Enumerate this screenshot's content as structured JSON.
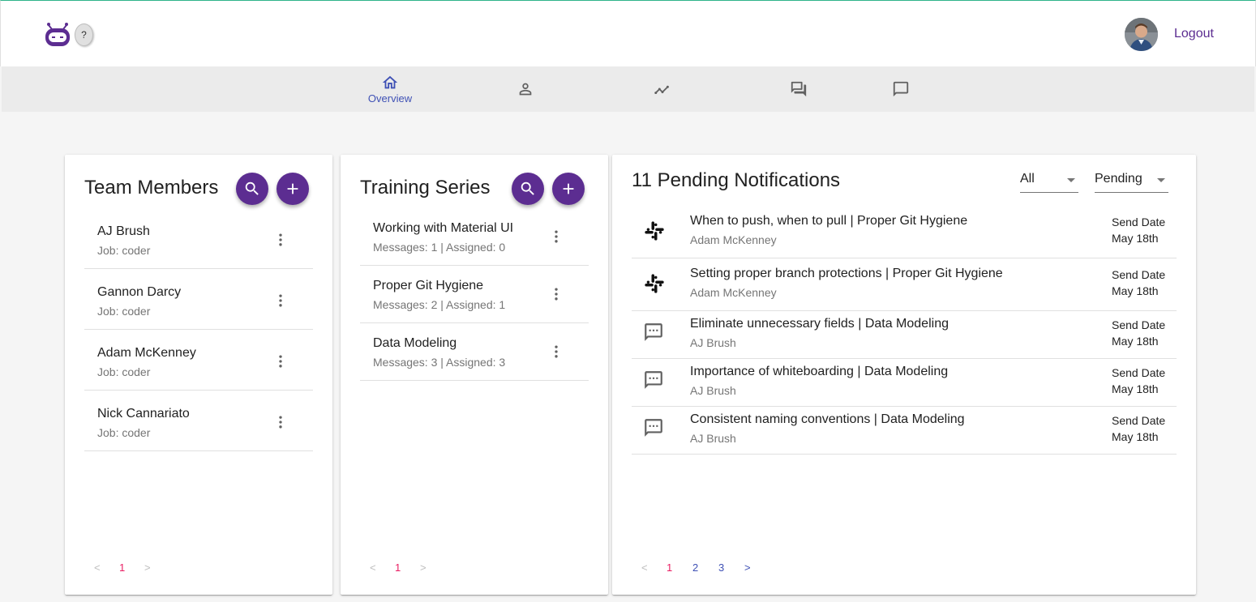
{
  "header": {
    "help_badge": "?",
    "logout_label": "Logout"
  },
  "nav": {
    "items": [
      {
        "icon": "home-icon",
        "label": "Overview",
        "active": true
      },
      {
        "icon": "person-icon",
        "label": ""
      },
      {
        "icon": "trending-icon",
        "label": ""
      },
      {
        "icon": "forum-icon",
        "label": ""
      },
      {
        "icon": "chat-bubble-icon",
        "label": ""
      }
    ]
  },
  "team": {
    "title": "Team Members",
    "members": [
      {
        "name": "AJ Brush",
        "job": "Job: coder"
      },
      {
        "name": "Gannon Darcy",
        "job": "Job: coder"
      },
      {
        "name": "Adam McKenney",
        "job": "Job: coder"
      },
      {
        "name": "Nick Cannariato",
        "job": "Job: coder"
      }
    ],
    "pager": {
      "prev": "<",
      "current": "1",
      "next": ">"
    }
  },
  "training": {
    "title": "Training Series",
    "series": [
      {
        "name": "Working with Material UI",
        "meta": "Messages: 1 | Assigned: 0"
      },
      {
        "name": "Proper Git Hygiene",
        "meta": "Messages: 2 | Assigned: 1"
      },
      {
        "name": "Data Modeling",
        "meta": "Messages: 3 | Assigned: 3"
      }
    ],
    "pager": {
      "prev": "<",
      "current": "1",
      "next": ">"
    }
  },
  "notifications": {
    "title": "11 Pending Notifications",
    "filter_all": "All",
    "filter_status": "Pending",
    "items": [
      {
        "icon": "slack-icon",
        "title": "When to push, when to pull | Proper Git Hygiene",
        "who": "Adam McKenney",
        "send_label": "Send Date",
        "send_date": "May 18th"
      },
      {
        "icon": "slack-icon",
        "title": "Setting proper branch protections | Proper Git Hygiene",
        "who": "Adam McKenney",
        "send_label": "Send Date",
        "send_date": "May 18th"
      },
      {
        "icon": "sms-icon",
        "title": "Eliminate unnecessary fields | Data Modeling",
        "who": "AJ Brush",
        "send_label": "Send Date",
        "send_date": "May 18th"
      },
      {
        "icon": "sms-icon",
        "title": "Importance of whiteboarding | Data Modeling",
        "who": "AJ Brush",
        "send_label": "Send Date",
        "send_date": "May 18th"
      },
      {
        "icon": "sms-icon",
        "title": "Consistent naming conventions | Data Modeling",
        "who": "AJ Brush",
        "send_label": "Send Date",
        "send_date": "May 18th"
      }
    ],
    "pager": {
      "prev": "<",
      "current": "1",
      "p2": "2",
      "p3": "3",
      "next": ">"
    }
  },
  "colors": {
    "primary": "#5c2d91",
    "link": "#3f51b5",
    "current_page": "#e91e63"
  }
}
